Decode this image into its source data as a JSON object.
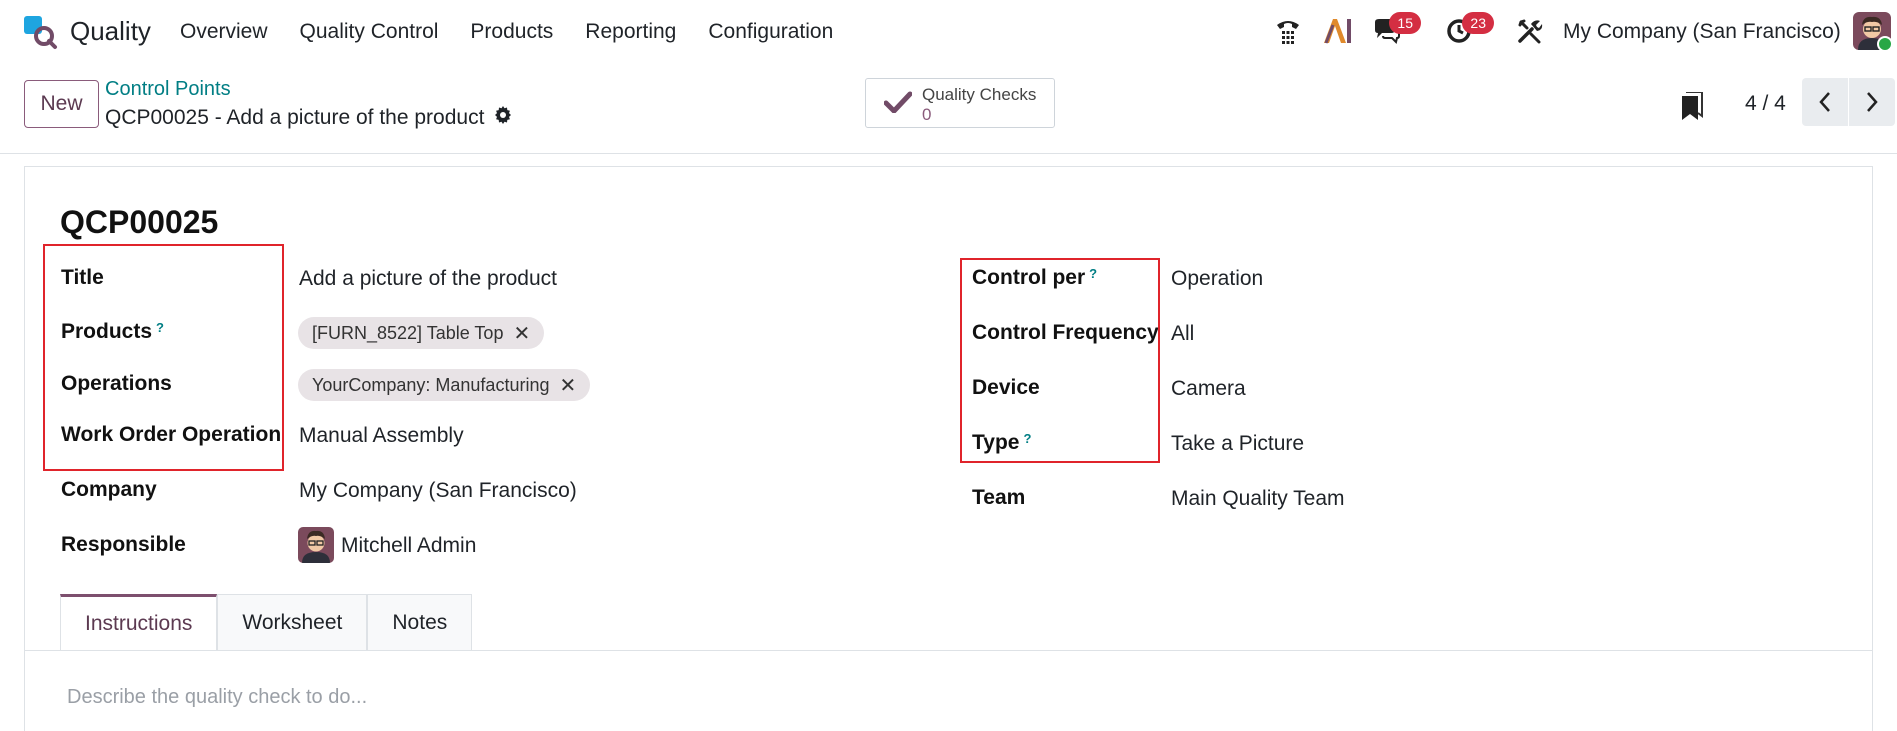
{
  "navbar": {
    "app_name": "Quality",
    "menu": [
      "Overview",
      "Quality Control",
      "Products",
      "Reporting",
      "Configuration"
    ],
    "messages_count": "15",
    "activities_count": "23",
    "company": "My Company (San Francisco)",
    "icons": [
      "phone-icon",
      "ai-icon",
      "chat-icon",
      "clock-icon",
      "tools-icon"
    ]
  },
  "control_panel": {
    "new_label": "New",
    "breadcrumb": "Control Points",
    "record_title": "QCP00025 - Add a picture of the product",
    "smart_button": {
      "label": "Quality Checks",
      "value": "0"
    },
    "pager": "4 / 4"
  },
  "form": {
    "reference": "QCP00025",
    "left": [
      {
        "label": "Title",
        "value": "Add a picture of the product"
      },
      {
        "label": "Products",
        "help": "?",
        "tags": [
          "[FURN_8522] Table Top"
        ]
      },
      {
        "label": "Operations",
        "tags": [
          "YourCompany: Manufacturing"
        ]
      },
      {
        "label": "Work Order Operation",
        "value": "Manual Assembly"
      },
      {
        "label": "Company",
        "value": "My Company (San Francisco)"
      },
      {
        "label": "Responsible",
        "value": "Mitchell Admin"
      }
    ],
    "right": [
      {
        "label": "Control per",
        "help": "?",
        "value": "Operation"
      },
      {
        "label": "Control Frequency",
        "value": "All"
      },
      {
        "label": "Device",
        "value": "Camera"
      },
      {
        "label": "Type",
        "help": "?",
        "value": "Take a Picture"
      },
      {
        "label": "Team",
        "value": "Main Quality Team"
      }
    ]
  },
  "tabs": [
    "Instructions",
    "Worksheet",
    "Notes"
  ],
  "instructions_placeholder": "Describe the quality check to do...",
  "colors": {
    "brand": "#714B67",
    "link": "#017e84",
    "highlight": "#e0242b",
    "badge": "#d42e42"
  }
}
